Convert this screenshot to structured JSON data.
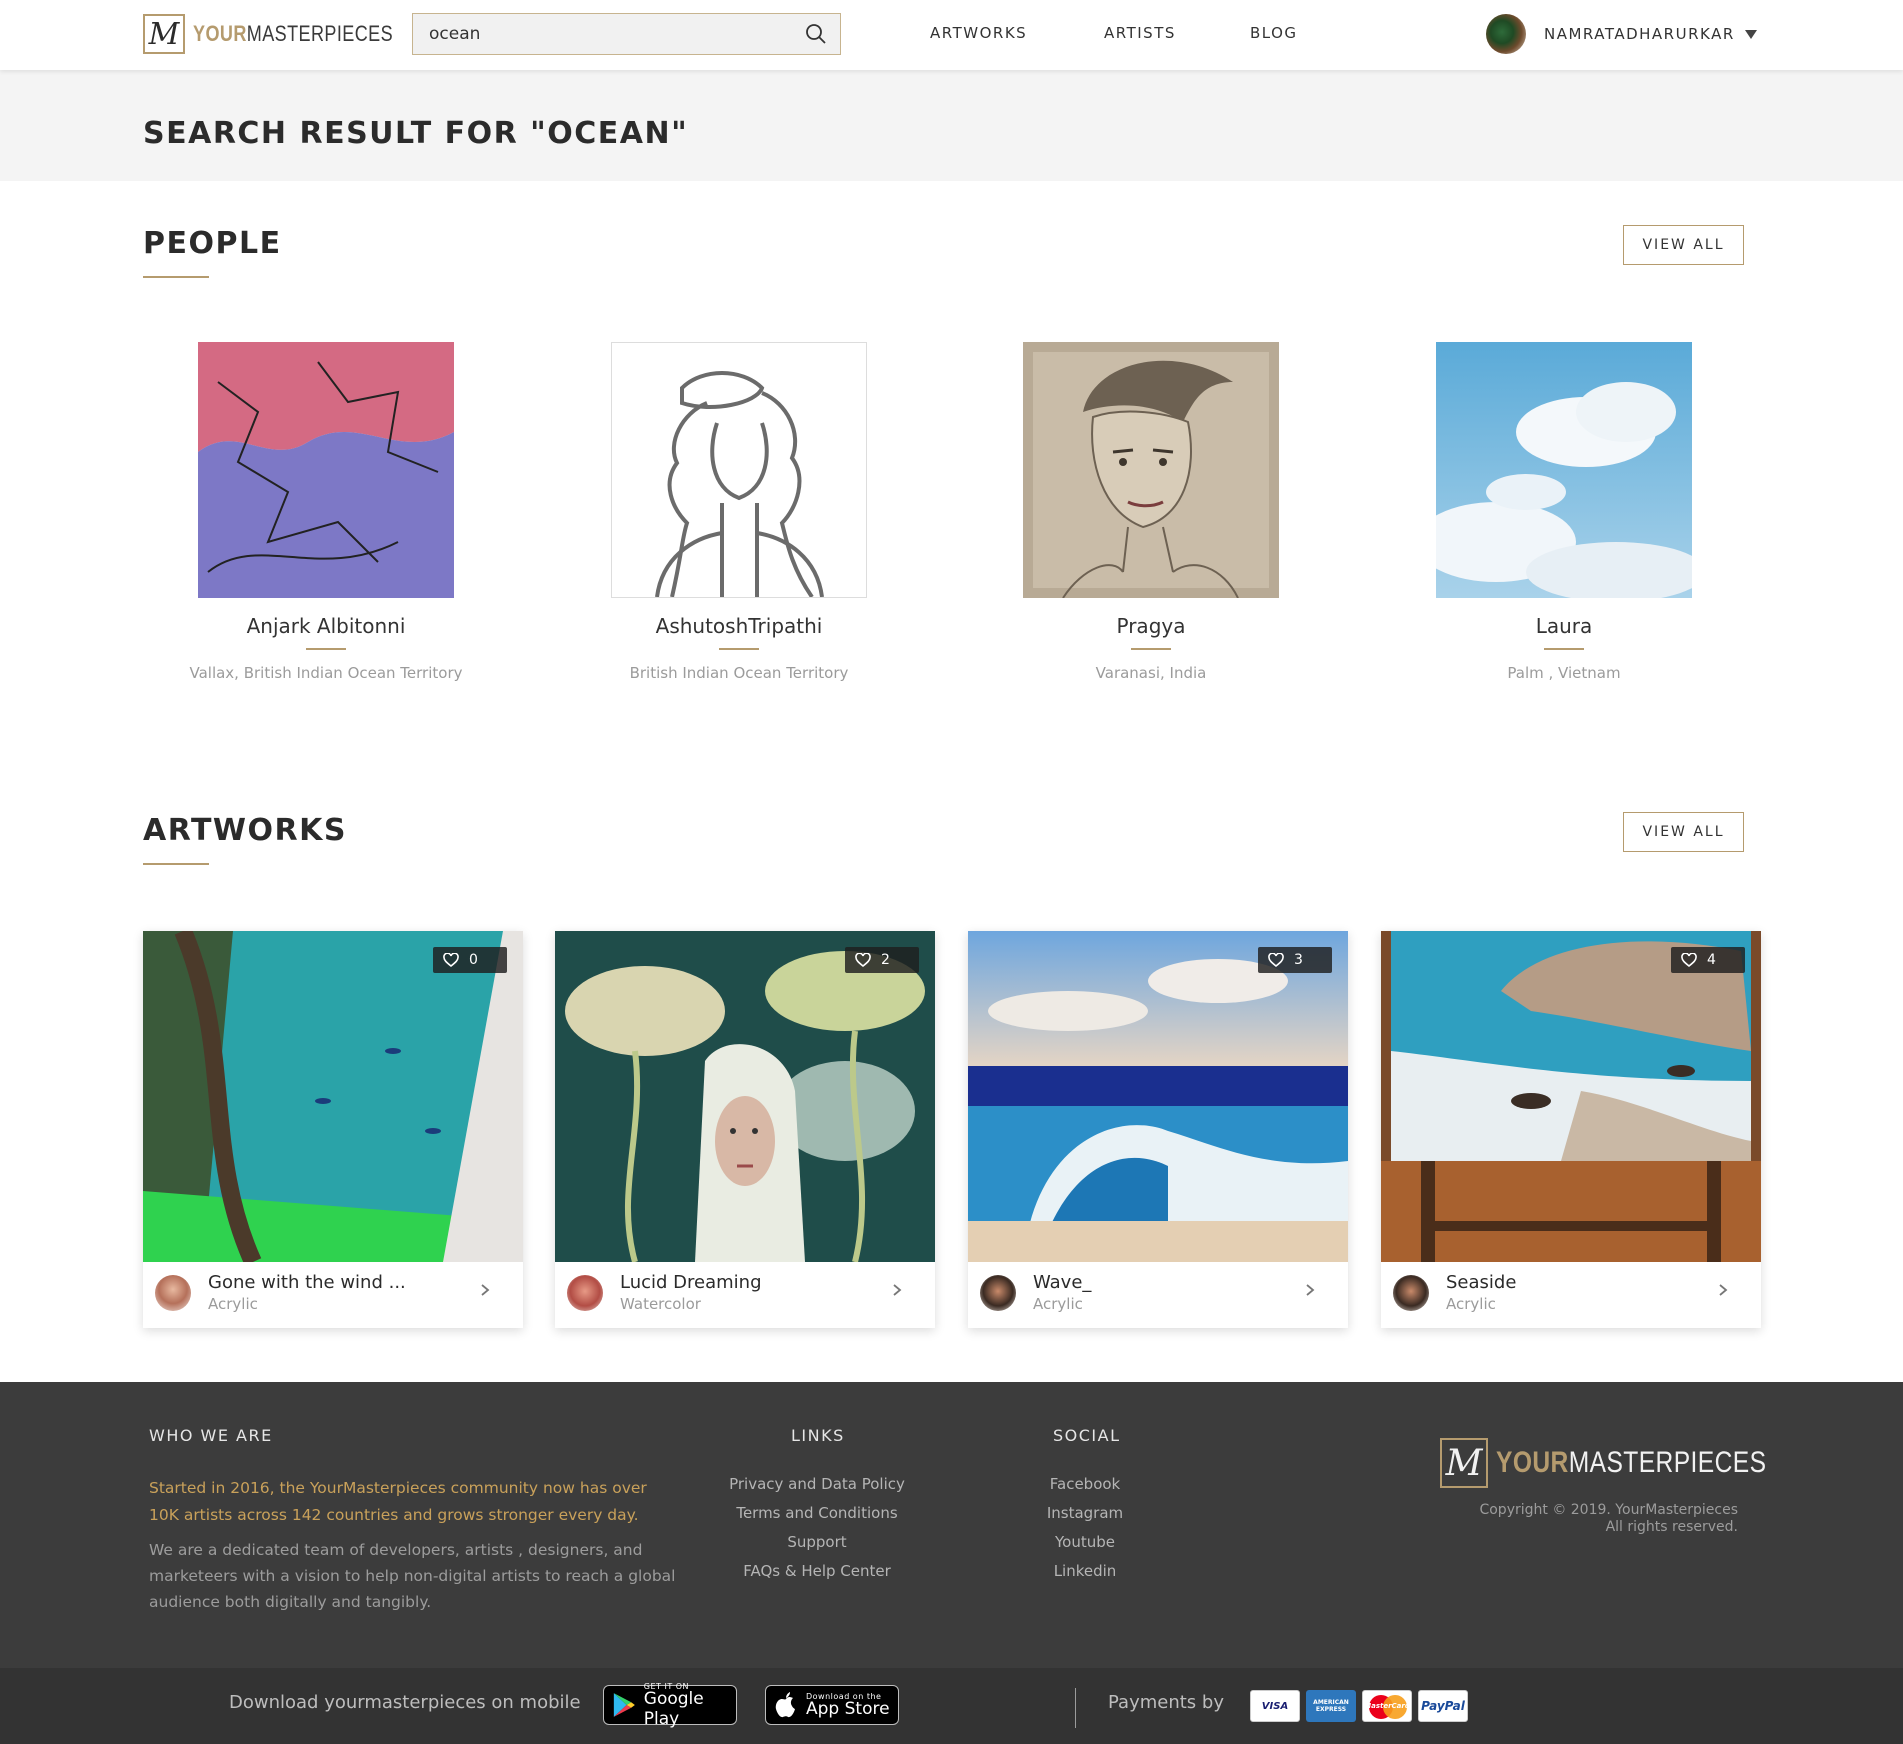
{
  "header": {
    "logo_part1": "YOUR",
    "logo_part2": "MASTERPIECES",
    "logo_mark": "M",
    "search_value": "ocean",
    "nav": [
      "ARTWORKS",
      "ARTISTS",
      "BLOG"
    ],
    "user_name": "NAMRATADHARURKAR"
  },
  "banner": {
    "title": "SEARCH RESULT FOR \"OCEAN\""
  },
  "people": {
    "title": "PEOPLE",
    "view_all": "VIEW ALL",
    "items": [
      {
        "name": "Anjark Albitonni",
        "location": "Vallax, British Indian Ocean Territory"
      },
      {
        "name": "AshutoshTripathi",
        "location": "British Indian Ocean Territory"
      },
      {
        "name": "Pragya",
        "location": "Varanasi, India"
      },
      {
        "name": "Laura",
        "location": "Palm , Vietnam"
      }
    ]
  },
  "artworks": {
    "title": "ARTWORKS",
    "view_all": "VIEW ALL",
    "items": [
      {
        "title": "Gone with the wind ...",
        "medium": "Acrylic",
        "likes": "0"
      },
      {
        "title": "Lucid Dreaming",
        "medium": "Watercolor",
        "likes": "2"
      },
      {
        "title": "Wave_",
        "medium": "Acrylic",
        "likes": "3"
      },
      {
        "title": "Seaside",
        "medium": "Acrylic",
        "likes": "4"
      }
    ]
  },
  "footer": {
    "who_title": "WHO WE ARE",
    "who_gold": "Started in 2016, the YourMasterpieces community now has over 10K artists across 142 countries and grows stronger every day.",
    "who_grey": "We are a dedicated team of developers, artists , designers, and marketeers with a vision to help non-digital artists to reach a global audience both digitally and tangibly.",
    "links_title": "LINKS",
    "links": [
      "Privacy and Data Policy",
      "Terms and Conditions",
      "Support",
      "FAQs & Help Center"
    ],
    "social_title": "SOCIAL",
    "social": [
      "Facebook",
      "Instagram",
      "Youtube",
      "Linkedin"
    ],
    "copyright_1": "Copyright © 2019. YourMasterpieces",
    "copyright_2": "All rights reserved."
  },
  "bottom": {
    "download_text": "Download yourmasterpieces on mobile",
    "google_small": "GET IT ON",
    "google_big": "Google Play",
    "apple_small": "Download on the",
    "apple_big": "App Store",
    "payments_text": "Payments by",
    "payments": [
      "VISA",
      "AMERICAN EXPRESS",
      "MasterCard",
      "PayPal"
    ]
  }
}
